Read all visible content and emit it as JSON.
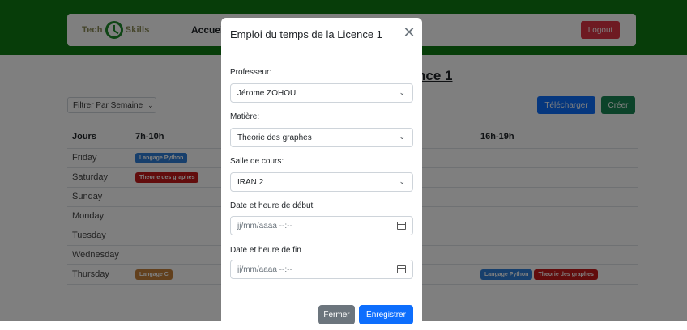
{
  "navbar": {
    "logo_left": "Tech",
    "logo_right": "Skills",
    "nav_link": "Accueil",
    "logout_label": "Logout"
  },
  "page": {
    "heading": "nce 1",
    "filter_label": "Filtrer Par Semaine",
    "download_label": "Télécharger",
    "create_label": "Créer"
  },
  "schedule": {
    "headers": [
      "Jours",
      "7h-10h",
      "",
      "",
      "16h-19h"
    ],
    "days": [
      "Friday",
      "Saturday",
      "Sunday",
      "Monday",
      "Tuesday",
      "Wednesday",
      "Thursday"
    ],
    "badges": {
      "friday_slot1": "Langage Python",
      "saturday_slot1": "Theorie des graphes",
      "thursday_slot1": "Langage C",
      "thursday_slot4a": "Langage Python",
      "thursday_slot4b": "Theorie des graphes"
    }
  },
  "colors": {
    "topbar": "#0e7a12",
    "primary": "#0d6efd",
    "success": "#198754",
    "danger": "#dc3545",
    "secondary": "#6c757d"
  },
  "modal": {
    "title": "Emploi du temps de la Licence 1",
    "close_icon": "close-icon",
    "fields": {
      "professor_label": "Professeur:",
      "professor_value": "Jérome ZOHOU",
      "subject_label": "Matière:",
      "subject_value": "Theorie des graphes",
      "room_label": "Salle de cours:",
      "room_value": "IRAN 2",
      "start_label": "Date et heure de début",
      "start_value": "jj/mm/aaaa --:--",
      "end_label": "Date et heure de fin",
      "end_value": "jj/mm/aaaa --:--"
    },
    "footer": {
      "close_label": "Fermer",
      "save_label": "Enregistrer"
    }
  }
}
